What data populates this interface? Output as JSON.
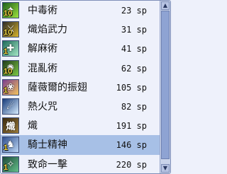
{
  "skills": [
    {
      "name": "中毒術",
      "sp": "23",
      "unit": "sp",
      "level": "10",
      "icon": "poison-skill-icon",
      "colors": [
        "#1d5e1d",
        "#9be33b"
      ],
      "glyph": "✦"
    },
    {
      "name": "熾焰武力",
      "sp": "31",
      "unit": "sp",
      "level": "10",
      "icon": "flame-force-skill-icon",
      "colors": [
        "#2b2b2b",
        "#d7b32a"
      ],
      "glyph": "⚔"
    },
    {
      "name": "解麻術",
      "sp": "41",
      "unit": "sp",
      "level": "1",
      "icon": "cure-paralysis-skill-icon",
      "colors": [
        "#1f6b5a",
        "#a4e6c4"
      ],
      "glyph": "✚"
    },
    {
      "name": "混亂術",
      "sp": "62",
      "unit": "sp",
      "level": "10",
      "icon": "confusion-skill-icon",
      "colors": [
        "#203a1c",
        "#7cc943"
      ],
      "glyph": "✺"
    },
    {
      "name": "薩薇爾的振翅",
      "sp": "105",
      "unit": "sp",
      "level": "1",
      "icon": "wing-flap-skill-icon",
      "colors": [
        "#7a3f8f",
        "#f3c35d"
      ],
      "glyph": "❀"
    },
    {
      "name": "熱火咒",
      "sp": "82",
      "unit": "sp",
      "level": "",
      "icon": "fire-curse-skill-icon",
      "colors": [
        "#173b7a",
        "#d6ecff"
      ],
      "glyph": "☄"
    },
    {
      "name": "熾",
      "sp": "191",
      "unit": "sp",
      "level": "",
      "icon": "blaze-skill-icon",
      "colors": [
        "#3a2a10",
        "#9a7a3a"
      ],
      "glyph": "熾"
    },
    {
      "name": "騎士精神",
      "sp": "146",
      "unit": "sp",
      "level": "1",
      "icon": "knight-spirit-skill-icon",
      "colors": [
        "#2f4f8f",
        "#bcd6f4"
      ],
      "glyph": "♞"
    },
    {
      "name": "致命一擊",
      "sp": "220",
      "unit": "sp",
      "level": "1",
      "icon": "critical-strike-skill-icon",
      "colors": [
        "#1d4a3a",
        "#66c08a"
      ],
      "glyph": "✧"
    }
  ],
  "selected_index": 7,
  "scrollbar": {
    "up_arrow": "▲",
    "down_arrow": "▼"
  },
  "colors": {
    "selected_row": "#a7c0e6",
    "panel_bg": "#eef1fb",
    "level_text": "#ffe24a"
  }
}
